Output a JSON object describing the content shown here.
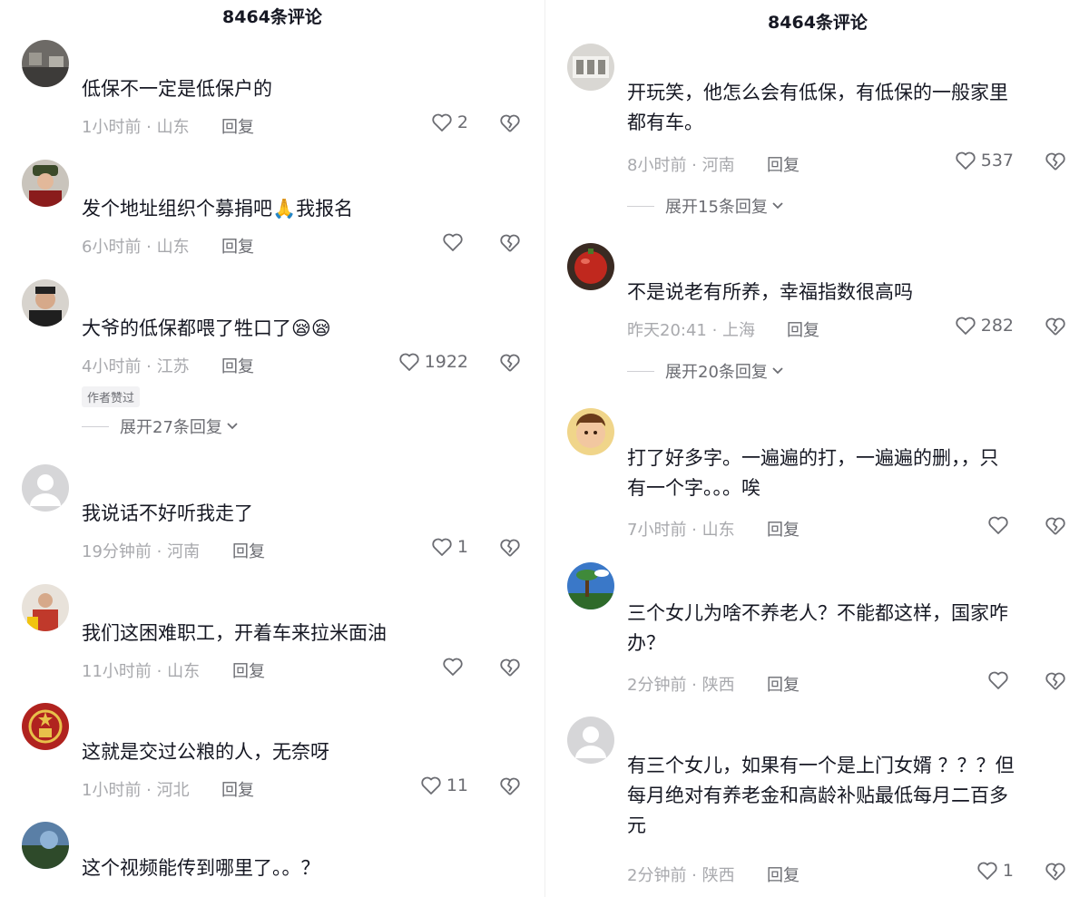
{
  "left": {
    "title": "8464条评论",
    "reply_label": "回复",
    "comments": [
      {
        "text": "低保不一定是低保户的",
        "meta": "1小时前 · 山东",
        "likes": "2"
      },
      {
        "text": "发个地址组织个募捐吧🙏我报名",
        "meta": "6小时前 · 山东",
        "likes": ""
      },
      {
        "text": "大爷的低保都喂了牲口了😪😪",
        "meta": "4小时前 · 江苏",
        "likes": "1922",
        "badge": "作者赞过",
        "expand": "展开27条回复"
      },
      {
        "text": "我说话不好听我走了",
        "meta": "19分钟前 · 河南",
        "likes": "1"
      },
      {
        "text": "我们这困难职工，开着车来拉米面油",
        "meta": "11小时前 · 山东",
        "likes": ""
      },
      {
        "text": "这就是交过公粮的人，无奈呀",
        "meta": "1小时前 · 河北",
        "likes": "11"
      },
      {
        "text": "这个视频能传到哪里了。。？",
        "meta": "",
        "likes": ""
      }
    ]
  },
  "right": {
    "title": "8464条评论",
    "reply_label": "回复",
    "comments": [
      {
        "text_lines": [
          "开玩笑，他怎么会有低保，有低保的一般家里",
          "都有车。"
        ],
        "meta": "8小时前 · 河南",
        "likes": "537",
        "expand": "展开15条回复"
      },
      {
        "text_lines": [
          "不是说老有所养，幸福指数很高吗"
        ],
        "meta": "昨天20:41 · 上海",
        "likes": "282",
        "expand": "展开20条回复"
      },
      {
        "text_lines": [
          "打了好多字。一遍遍的打，一遍遍的删，，只",
          "有一个字。。。唉"
        ],
        "meta": "7小时前 · 山东",
        "likes": ""
      },
      {
        "text_lines": [
          "三个女儿为啥不养老人？不能都这样，国家咋",
          "办？"
        ],
        "meta": "2分钟前 · 陕西",
        "likes": ""
      },
      {
        "text_lines": [
          "有三个女儿，如果有一个是上门女婿 ？？？但",
          "每月绝对有养老金和高龄补贴最低每月二百多",
          "元"
        ],
        "meta": "2分钟前 · 陕西",
        "likes": "1"
      }
    ]
  },
  "icons": {
    "like": "heart-outline-icon",
    "dislike": "broken-heart-icon",
    "expand": "chevron-down-icon"
  }
}
